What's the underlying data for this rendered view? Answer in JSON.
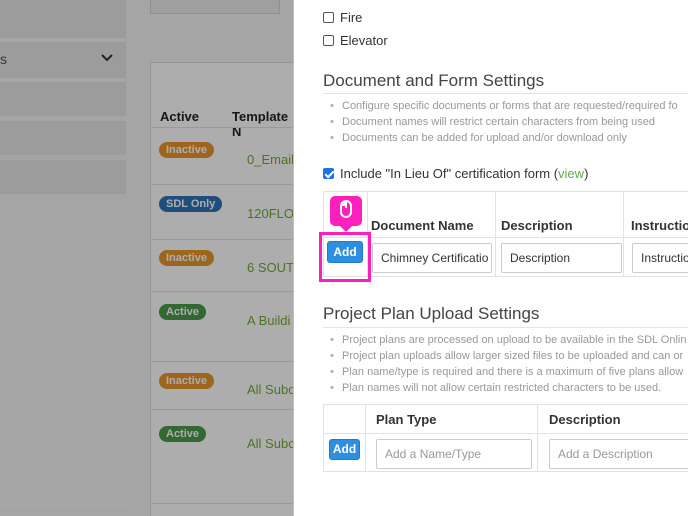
{
  "background": {
    "sidebar": {
      "label_fragment": "s"
    },
    "table": {
      "headers": {
        "active": "Active",
        "template_name": "Template N"
      },
      "rows": [
        {
          "status": "Inactive",
          "status_kind": "inactive",
          "name": "0_Email"
        },
        {
          "status": "SDL Only",
          "status_kind": "sdl",
          "name": "120FLO"
        },
        {
          "status": "Inactive",
          "status_kind": "inactive",
          "name": "6 SOUT"
        },
        {
          "status": "Active",
          "status_kind": "active",
          "name": "A Buildi"
        },
        {
          "status": "Inactive",
          "status_kind": "inactive",
          "name": "All Subc"
        },
        {
          "status": "Active",
          "status_kind": "active",
          "name": "All Subc"
        }
      ]
    }
  },
  "panel": {
    "checkboxes": [
      {
        "label": "Fire",
        "checked": false
      },
      {
        "label": "Elevator",
        "checked": false
      }
    ],
    "document_section": {
      "title": "Document and Form Settings",
      "bullets": [
        "Configure specific documents or forms that are requested/required fo",
        "Document names will restrict certain characters from being used",
        "Documents can be added for upload and/or download only"
      ],
      "lieu_checkbox": {
        "label": "Include \"In Lieu Of\" certification form (",
        "link": "view",
        "suffix": ")",
        "checked": true
      },
      "table": {
        "headers": {
          "document_name": "Document Name",
          "description": "Description",
          "instructions": "Instructio"
        },
        "add_label": "Add",
        "row": {
          "document_name": "Chimney Certificatio",
          "description": "Description",
          "instructions": "Instructio"
        }
      }
    },
    "plan_section": {
      "title": "Project Plan Upload Settings",
      "bullets": [
        "Project plans are processed on upload to be available in the SDL Onlin",
        "Project plan uploads allow larger sized files to be uploaded and can or",
        "Plan name/type is required and there is a maximum of five plans allow",
        "Plan names will not allow certain restricted characters to be used."
      ],
      "table": {
        "headers": {
          "plan_type": "Plan Type",
          "description": "Description"
        },
        "add_label": "Add",
        "placeholders": {
          "plan_type": "Add a Name/Type",
          "description": "Add a Description"
        }
      }
    }
  },
  "colors": {
    "highlight": "#ff1fbf",
    "add_button": "#2d8fe0",
    "link": "#6aa84f",
    "inactive_badge": "#e8962d",
    "sdl_badge": "#2f73b8",
    "active_badge": "#4a9a4a"
  },
  "icons": {
    "pointer": "mouse-click-icon",
    "sidebar_chevron": "chevron-down-icon"
  }
}
